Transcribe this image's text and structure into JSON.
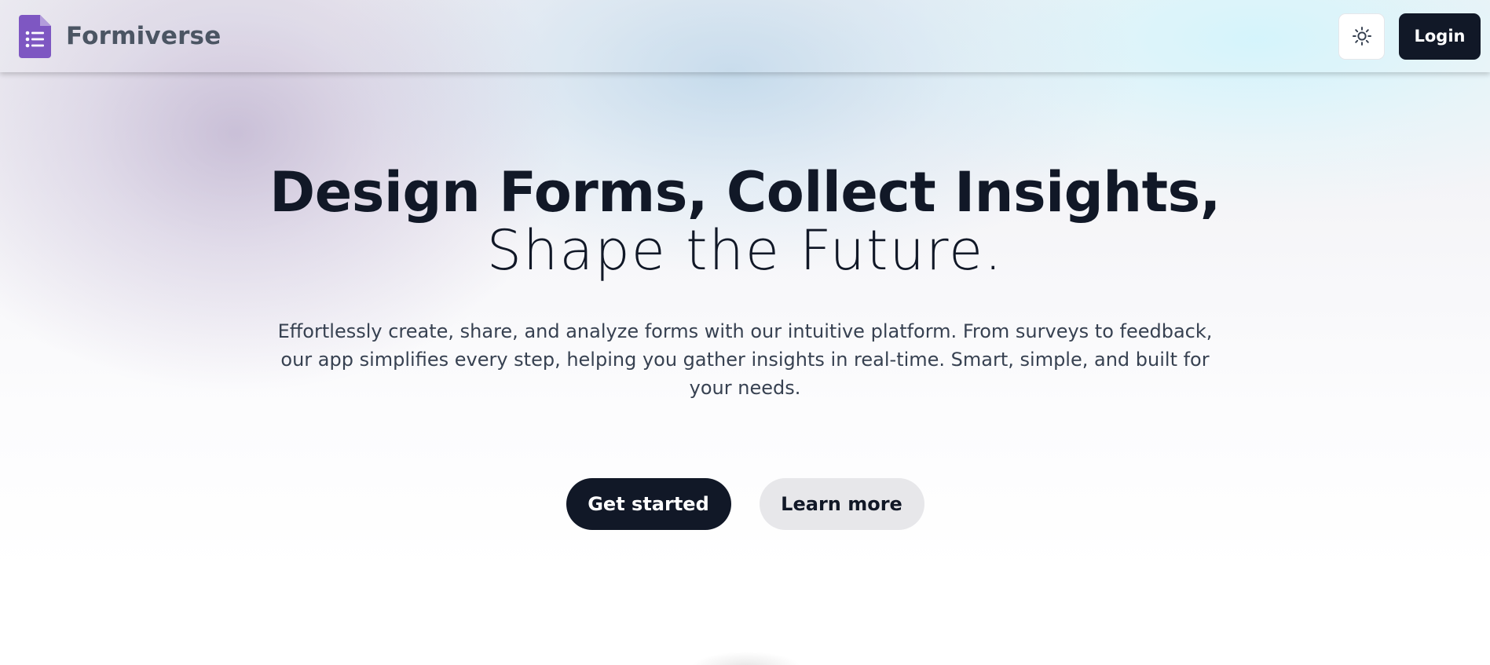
{
  "header": {
    "brand": {
      "name": "Formiverse",
      "logo_icon": "google-forms-like-list-document-icon"
    },
    "actions": {
      "theme_toggle_icon": "sun-icon",
      "login_label": "Login"
    }
  },
  "hero": {
    "title_line_1": "Design Forms, Collect Insights,",
    "title_line_2": "Shape the Future.",
    "description": "Effortlessly create, share, and analyze forms with our intuitive platform. From surveys to feedback, our app simplifies every step, helping you gather insights in real-time. Smart, simple, and built for your needs."
  },
  "cta": {
    "primary_label": "Get started",
    "secondary_label": "Learn more"
  },
  "colors": {
    "brand_purple": "#7e57c2",
    "dark": "#111827",
    "muted_text": "#4b5563",
    "secondary_button": "#e7e7ea"
  }
}
